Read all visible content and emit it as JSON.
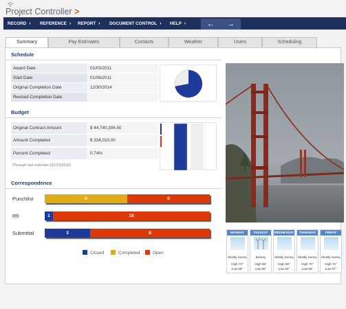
{
  "app": {
    "title": "Project Controller",
    "title_arrow": ">"
  },
  "nav": {
    "items": [
      "RECORD",
      "REFERENCE",
      "REPORT",
      "DOCUMENT CONTROL",
      "HELP"
    ],
    "chevron": "›",
    "back_arrow": "←",
    "forward_arrow": "→"
  },
  "tabs": [
    "Summary",
    "Pay Estimates",
    "Contacts",
    "Weather",
    "Users",
    "Scheduling"
  ],
  "active_tab": "Summary",
  "schedule": {
    "title": "Schedule",
    "rows": [
      {
        "label": "Award Date",
        "value": "01/03/2011"
      },
      {
        "label": "Start Date",
        "value": "01/06/2011"
      },
      {
        "label": "Original Completion Date",
        "value": "12/30/2014"
      },
      {
        "label": "Revised Completion Date",
        "value": ""
      }
    ],
    "pie_completed_fraction": 0.72
  },
  "budget": {
    "title": "Budget",
    "rows": [
      {
        "label": "Original Contract Amount",
        "value": "$ 44,740,306.50"
      },
      {
        "label": "Amount Completed",
        "value": "$ 334,010.00"
      },
      {
        "label": "Percent Completed",
        "value": "0.74%"
      }
    ],
    "note": "Through last estimate (01/15/2011)"
  },
  "correspondence": {
    "title": "Correspondence",
    "rows": [
      {
        "label": "Punchlist",
        "closed": 0,
        "completed": 0,
        "open": 0,
        "closed_label": "",
        "completed_label": "0",
        "open_label": "0"
      },
      {
        "label": "Rfi",
        "closed": 1,
        "completed": 0,
        "open": 18,
        "closed_label": "1",
        "completed_label": "",
        "open_label": "18"
      },
      {
        "label": "Submittal",
        "closed": 3,
        "completed": 0,
        "open": 8,
        "closed_label": "3",
        "completed_label": "",
        "open_label": "8"
      }
    ],
    "legend": [
      "Closed",
      "Completed",
      "Open"
    ]
  },
  "colors": {
    "closed": "#1e3a9a",
    "completed": "#e0ac18",
    "open": "#dd3a0c",
    "nav_bg": "#1f2f5c",
    "section_title": "#1f3a7a"
  },
  "weather": [
    {
      "day": "MONDAY",
      "desc": "Mostly Sunny",
      "high": "High 73°",
      "low": "Low 59°",
      "icon": "sunny-icon"
    },
    {
      "day": "TUESDAY",
      "desc": "Breezy",
      "high": "High 69°",
      "low": "Low 55°",
      "icon": "windmill-icon"
    },
    {
      "day": "WEDNESDAY",
      "desc": "Mostly Sunny",
      "high": "High 69°",
      "low": "Low 54°",
      "icon": "sunny-icon"
    },
    {
      "day": "THURSDAY",
      "desc": "Mostly Sunny",
      "high": "High 70°",
      "low": "Low 55°",
      "icon": "sunny-icon"
    },
    {
      "day": "FRIDAY",
      "desc": "Mostly Sunny",
      "high": "High 72°",
      "low": "Low 57°",
      "icon": "sunny-icon"
    }
  ],
  "photo": {
    "icon": "golden-gate-bridge-photo"
  }
}
